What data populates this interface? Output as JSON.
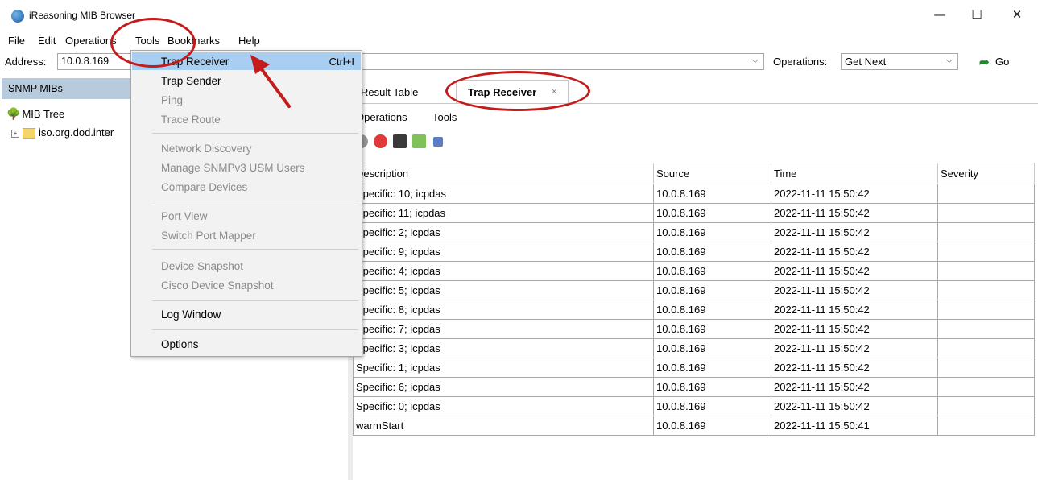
{
  "window": {
    "title": "iReasoning MIB Browser",
    "minimize": "—",
    "maximize": "☐",
    "close": "✕"
  },
  "menubar": [
    "File",
    "Edit",
    "Operations",
    "Tools",
    "Bookmarks",
    "Help"
  ],
  "address": {
    "label": "Address:",
    "value": "10.0.8.169"
  },
  "operations": {
    "label": "Operations:",
    "value": "Get Next",
    "go": "Go"
  },
  "left": {
    "header": "SNMP MIBs",
    "tree_root": "MIB Tree",
    "tree_child": "iso.org.dod.inter"
  },
  "tabs": {
    "result": "Result Table",
    "trap": "Trap Receiver"
  },
  "submenu": [
    "Operations",
    "Tools"
  ],
  "table": {
    "headers": [
      "Description",
      "Source",
      "Time",
      "Severity"
    ],
    "rows": [
      [
        "Specific: 10; icpdas",
        "10.0.8.169",
        "2022-11-11 15:50:42",
        ""
      ],
      [
        "Specific: 11; icpdas",
        "10.0.8.169",
        "2022-11-11 15:50:42",
        ""
      ],
      [
        "Specific: 2; icpdas",
        "10.0.8.169",
        "2022-11-11 15:50:42",
        ""
      ],
      [
        "Specific: 9; icpdas",
        "10.0.8.169",
        "2022-11-11 15:50:42",
        ""
      ],
      [
        "Specific: 4; icpdas",
        "10.0.8.169",
        "2022-11-11 15:50:42",
        ""
      ],
      [
        "Specific: 5; icpdas",
        "10.0.8.169",
        "2022-11-11 15:50:42",
        ""
      ],
      [
        "Specific: 8; icpdas",
        "10.0.8.169",
        "2022-11-11 15:50:42",
        ""
      ],
      [
        "Specific: 7; icpdas",
        "10.0.8.169",
        "2022-11-11 15:50:42",
        ""
      ],
      [
        "Specific: 3; icpdas",
        "10.0.8.169",
        "2022-11-11 15:50:42",
        ""
      ],
      [
        "Specific: 1; icpdas",
        "10.0.8.169",
        "2022-11-11 15:50:42",
        ""
      ],
      [
        "Specific: 6; icpdas",
        "10.0.8.169",
        "2022-11-11 15:50:42",
        ""
      ],
      [
        "Specific: 0; icpdas",
        "10.0.8.169",
        "2022-11-11 15:50:42",
        ""
      ],
      [
        "warmStart",
        "10.0.8.169",
        "2022-11-11 15:50:41",
        ""
      ]
    ]
  },
  "tools_menu": {
    "trap_receiver": "Trap Receiver",
    "trap_receiver_shortcut": "Ctrl+I",
    "trap_sender": "Trap Sender",
    "ping": "Ping",
    "trace_route": "Trace Route",
    "network_discovery": "Network Discovery",
    "manage_snmpv3": "Manage SNMPv3 USM Users",
    "compare_devices": "Compare Devices",
    "port_view": "Port View",
    "switch_port_mapper": "Switch Port Mapper",
    "device_snapshot": "Device Snapshot",
    "cisco_device_snapshot": "Cisco Device Snapshot",
    "log_window": "Log Window",
    "options": "Options"
  },
  "colors": {
    "selection": "#a8cef2",
    "annotation": "#c41c1c",
    "panel_header": "#b8cbdc"
  }
}
